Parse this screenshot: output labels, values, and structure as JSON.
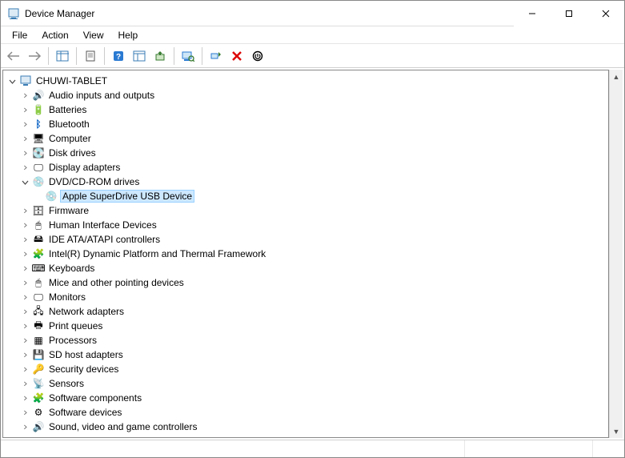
{
  "title": "Device Manager",
  "menu": {
    "file": "File",
    "action": "Action",
    "view": "View",
    "help": "Help"
  },
  "root": "CHUWI-TABLET",
  "categories": [
    {
      "label": "Audio inputs and outputs",
      "icon": "🔊"
    },
    {
      "label": "Batteries",
      "icon": "🔋"
    },
    {
      "label": "Bluetooth",
      "icon": "ᛒ",
      "iconColor": "#0a62c4"
    },
    {
      "label": "Computer",
      "icon": "🖥"
    },
    {
      "label": "Disk drives",
      "icon": "💽"
    },
    {
      "label": "Display adapters",
      "icon": "🖵"
    },
    {
      "label": "DVD/CD-ROM drives",
      "icon": "💿",
      "expanded": true,
      "child": {
        "label": "Apple SuperDrive USB Device",
        "icon": "💿",
        "selected": true
      }
    },
    {
      "label": "Firmware",
      "icon": "🗄"
    },
    {
      "label": "Human Interface Devices",
      "icon": "🖱"
    },
    {
      "label": "IDE ATA/ATAPI controllers",
      "icon": "🖴"
    },
    {
      "label": "Intel(R) Dynamic Platform and Thermal Framework",
      "icon": "🧩"
    },
    {
      "label": "Keyboards",
      "icon": "⌨"
    },
    {
      "label": "Mice and other pointing devices",
      "icon": "🖱"
    },
    {
      "label": "Monitors",
      "icon": "🖵"
    },
    {
      "label": "Network adapters",
      "icon": "🖧"
    },
    {
      "label": "Print queues",
      "icon": "🖶"
    },
    {
      "label": "Processors",
      "icon": "▦"
    },
    {
      "label": "SD host adapters",
      "icon": "💾"
    },
    {
      "label": "Security devices",
      "icon": "🔑"
    },
    {
      "label": "Sensors",
      "icon": "📡"
    },
    {
      "label": "Software components",
      "icon": "🧩"
    },
    {
      "label": "Software devices",
      "icon": "⚙"
    },
    {
      "label": "Sound, video and game controllers",
      "icon": "🔊"
    }
  ]
}
